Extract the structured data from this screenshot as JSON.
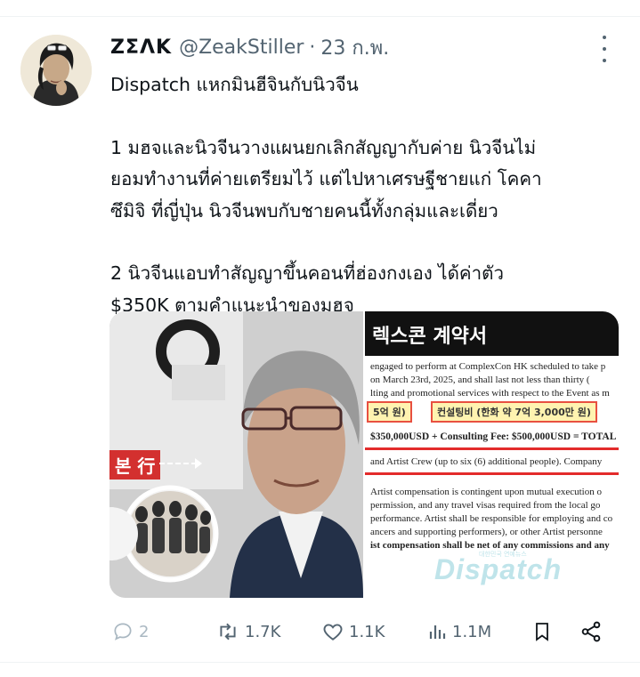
{
  "tweet": {
    "display_name": "ZΣΛK",
    "handle": "@ZeakStiller",
    "separator": "·",
    "time": "23 ก.พ.",
    "lines": [
      "Dispatch แหกมินฮีจินกับนิวจีน",
      "1 มฮจและนิวจีนวางแผนยกเลิกสัญญากับค่าย นิวจีนไม่",
      "ยอมทำงานที่ค่ายเตรียมไว้ แต่ไปหาเศรษฐีชายแก่ โคคา",
      "ซึมิจิ ที่ญี่ปุ่น นิวจีนพบกับชายคนนี้ทั้งกลุ่มและเดี่ยว",
      "2 นิวจีนแอบทำสัญญาขึ้นคอนที่ฮ่องกงเอง ได้ค่าตัว",
      "$350K ตามคำแนะนำของมฮจ"
    ]
  },
  "media": {
    "left_label": "본 行",
    "document_title": "렉스콘 계약서",
    "document_lines": [
      "engaged to perform at ComplexCon HK scheduled to take p",
      "on March 23rd, 2025, and shall last not less than thirty (",
      "lting and promotional services with respect to the Event as m",
      "$350,000USD + Consulting Fee: $500,000USD = TOTAL",
      "and Artist Crew (up to six (6) additional people). Company",
      "Artist compensation is contingent upon mutual execution o",
      "permission, and any travel visas required from the local go",
      "performance. Artist shall be responsible for employing and co",
      "ancers and supporting performers), or other Artist personne",
      "ist compensation shall be net of any commissions and any"
    ],
    "box1": "5억 원)",
    "box2": "컨설팅비 (한화 약 7억 3,000만 원)",
    "watermark": "Dispatch",
    "watermark_small": "대한민국 연예뉴스"
  },
  "actions": {
    "replies": "2",
    "retweets": "1.7K",
    "likes": "1.1K",
    "views": "1.1M"
  },
  "icons": [
    "avatar",
    "more-options-icon",
    "reply-icon",
    "retweet-icon",
    "like-icon",
    "views-icon",
    "bookmark-icon",
    "share-icon"
  ],
  "colors": {
    "text": "#0f1419",
    "secondary": "#536471",
    "divider": "#eff3f4",
    "accent_red": "#d3302f"
  }
}
